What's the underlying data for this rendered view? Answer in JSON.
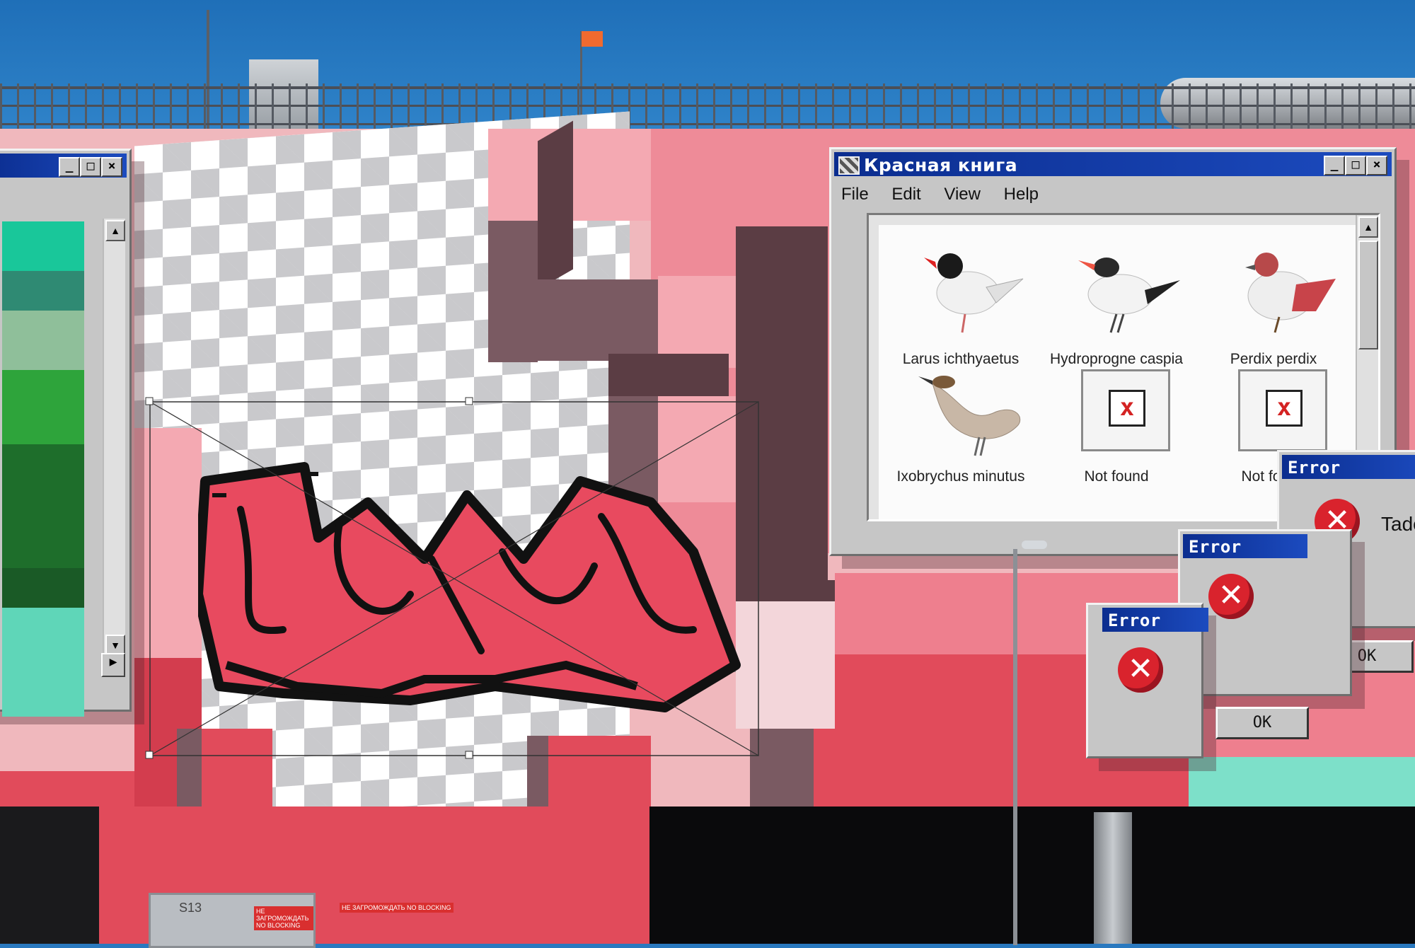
{
  "main_window": {
    "title": "Красная книга",
    "menu": [
      "File",
      "Edit",
      "View",
      "Help"
    ],
    "items": [
      {
        "label": "Larus ichthyaetus",
        "icon": "black-headed-gull-icon"
      },
      {
        "label": "Hydroprogne caspia",
        "icon": "caspian-tern-icon"
      },
      {
        "label": "Perdix perdix",
        "icon": "partridge-icon"
      },
      {
        "label": "Ixobrychus minutus",
        "icon": "little-bittern-icon"
      },
      {
        "label": "Not found",
        "icon": "broken-image-icon"
      },
      {
        "label": "Not found",
        "icon": "broken-image-icon"
      }
    ]
  },
  "errors": [
    {
      "title": "Error",
      "message": "Tade",
      "ok": "OK"
    },
    {
      "title": "Error",
      "ok": "OK"
    },
    {
      "title": "Error"
    }
  ],
  "building": {
    "door_code": "S13",
    "signs": [
      "НЕ ЗАГРОМОЖДАТЬ NO BLOCKING",
      "НЕ ЗАГРОМОЖДАТЬ NO BLOCKING"
    ]
  },
  "colors": {
    "sky": "#2a79bf",
    "facade_pink": "#f0b8bd",
    "facade_red": "#e14b5b",
    "titlebar_blue": "#0b2d8f",
    "window_grey": "#c6c6c6",
    "mint": "#7de0c9"
  }
}
